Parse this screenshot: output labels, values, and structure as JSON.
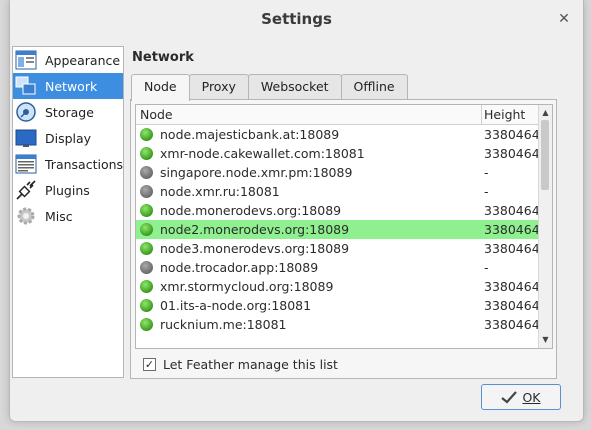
{
  "window": {
    "title": "Settings",
    "close_glyph": "✕"
  },
  "sidebar": {
    "items": [
      {
        "label": "Appearance",
        "icon": "appearance-icon",
        "selected": false
      },
      {
        "label": "Network",
        "icon": "network-icon",
        "selected": true
      },
      {
        "label": "Storage",
        "icon": "storage-icon",
        "selected": false
      },
      {
        "label": "Display",
        "icon": "display-icon",
        "selected": false
      },
      {
        "label": "Transactions",
        "icon": "transactions-icon",
        "selected": false
      },
      {
        "label": "Plugins",
        "icon": "plugins-icon",
        "selected": false
      },
      {
        "label": "Misc",
        "icon": "gear-icon",
        "selected": false
      }
    ]
  },
  "section_title": "Network",
  "tabs": [
    {
      "label": "Node",
      "active": true
    },
    {
      "label": "Proxy",
      "active": false
    },
    {
      "label": "Websocket",
      "active": false
    },
    {
      "label": "Offline",
      "active": false
    }
  ],
  "table": {
    "headers": {
      "node": "Node",
      "height": "Height"
    },
    "rows": [
      {
        "node": "node.majesticbank.at:18089",
        "height": "3380464",
        "status": "green",
        "selected": false
      },
      {
        "node": "xmr-node.cakewallet.com:18081",
        "height": "3380464",
        "status": "green",
        "selected": false
      },
      {
        "node": "singapore.node.xmr.pm:18089",
        "height": "-",
        "status": "grey",
        "selected": false
      },
      {
        "node": "node.xmr.ru:18081",
        "height": "-",
        "status": "grey",
        "selected": false
      },
      {
        "node": "node.monerodevs.org:18089",
        "height": "3380464",
        "status": "green",
        "selected": false
      },
      {
        "node": "node2.monerodevs.org:18089",
        "height": "3380464",
        "status": "green",
        "selected": true
      },
      {
        "node": "node3.monerodevs.org:18089",
        "height": "3380464",
        "status": "green",
        "selected": false
      },
      {
        "node": "node.trocador.app:18089",
        "height": "-",
        "status": "grey",
        "selected": false
      },
      {
        "node": "xmr.stormycloud.org:18089",
        "height": "3380464",
        "status": "green",
        "selected": false
      },
      {
        "node": "01.its-a-node.org:18081",
        "height": "3380464",
        "status": "green",
        "selected": false
      },
      {
        "node": "rucknium.me:18081",
        "height": "3380464",
        "status": "green",
        "selected": false
      }
    ]
  },
  "checkbox": {
    "label": "Let Feather manage this list",
    "checked": true,
    "check_glyph": "✓"
  },
  "ok_button": {
    "label": "OK"
  },
  "colors": {
    "sidebar_selected": "#3d8ee0",
    "row_selected": "#8ef08e",
    "status_green": "#3c9a1e",
    "status_grey": "#6a6a6a"
  }
}
